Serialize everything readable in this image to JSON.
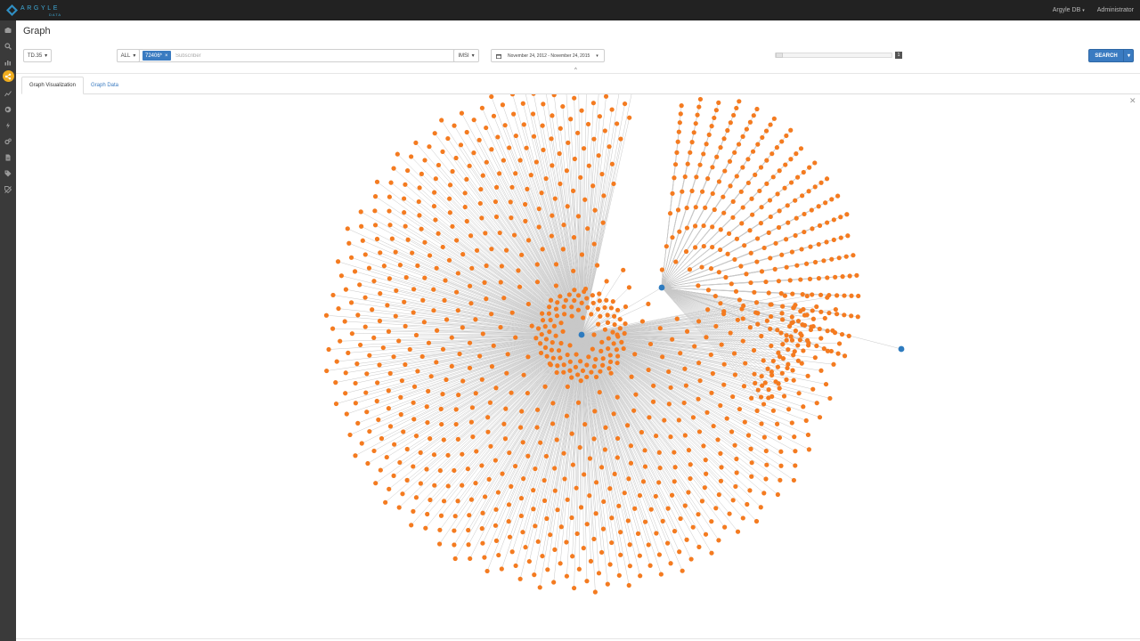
{
  "header": {
    "brand": "ARGYLE",
    "brand_sub": "DATA",
    "db_menu": "Argyle DB",
    "user": "Administrator"
  },
  "sidebar": {
    "items": [
      {
        "icon": "dashboard-icon",
        "active": false
      },
      {
        "icon": "search-icon",
        "active": false
      },
      {
        "icon": "bar-chart-icon",
        "active": false
      },
      {
        "icon": "share-graph-icon",
        "active": true
      },
      {
        "icon": "line-chart-icon",
        "active": false
      },
      {
        "icon": "globe-icon",
        "active": false
      },
      {
        "icon": "bolt-icon",
        "active": false
      },
      {
        "icon": "cogs-icon",
        "active": false
      },
      {
        "icon": "file-icon",
        "active": false
      },
      {
        "icon": "tags-icon",
        "active": false
      },
      {
        "icon": "tag-off-icon",
        "active": false
      }
    ]
  },
  "page": {
    "title": "Graph"
  },
  "toolbar": {
    "dataset": "TD.35",
    "scope": "ALL",
    "tag": "72406*",
    "search_placeholder": "Subscriber",
    "id_type": "IMSI",
    "date_range": "November 24, 2012 - November 24, 2015",
    "depth_value": "1",
    "search_label": "SEARCH"
  },
  "tabs": [
    {
      "label": "Graph Visualization",
      "active": true
    },
    {
      "label": "Graph Data",
      "active": false
    }
  ],
  "graph": {
    "hub_color": "#2e7bbf",
    "leaf_color": "#f47b20",
    "edge_color": "#c8c8c8",
    "hubs": 3
  }
}
